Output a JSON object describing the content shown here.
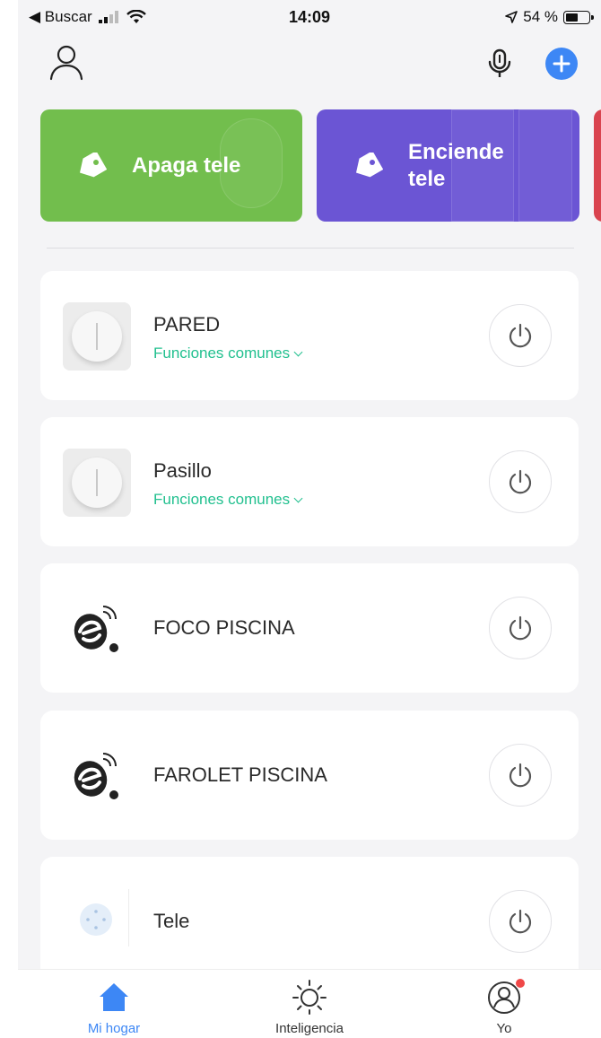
{
  "status_bar": {
    "back_label": "◀ Buscar",
    "time": "14:09",
    "battery": "54 %",
    "battery_level": 0.54
  },
  "header": {
    "icons": [
      "user-icon",
      "microphone-icon",
      "plus-icon"
    ]
  },
  "scenes": [
    {
      "label": "Apaga tele",
      "color": "#72be4d",
      "icon": "tag-icon"
    },
    {
      "label": "Enciende tele",
      "color": "#6b55d4",
      "icon": "tag-icon"
    }
  ],
  "devices": [
    {
      "name": "PARED",
      "functions": "Funciones comunes",
      "icon": "wall-switch-icon"
    },
    {
      "name": "Pasillo",
      "functions": "Funciones comunes",
      "icon": "wall-switch-icon"
    },
    {
      "name": "FOCO PISCINA",
      "icon": "wifi-brand-logo-icon"
    },
    {
      "name": "FAROLET PISCINA",
      "icon": "wifi-brand-logo-icon"
    },
    {
      "name": "Tele",
      "icon": "smart-plug-icon"
    }
  ],
  "tabbar": {
    "home": "Mi hogar",
    "smart": "Inteligencia",
    "me": "Yo"
  },
  "colors": {
    "accent": "#3d87f5",
    "function_link": "#22c08f",
    "badge": "#f04848"
  }
}
